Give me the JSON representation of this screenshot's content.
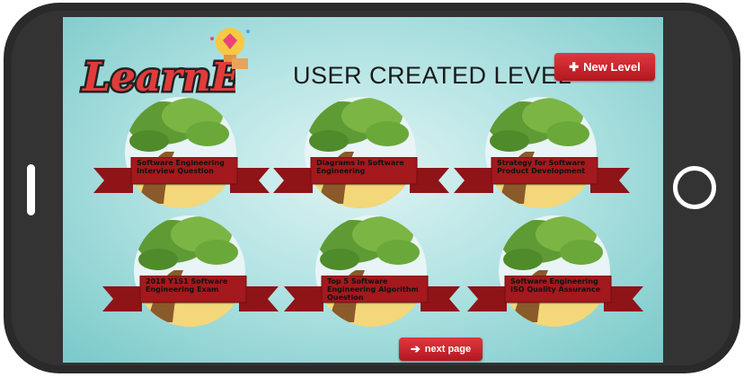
{
  "app": {
    "logo_text": "LearnEz",
    "title": "USER CREATED LEVEL"
  },
  "header": {
    "new_level_label": "New Level",
    "new_level_icon": "plus-icon"
  },
  "levels": [
    {
      "label": "Software Engineering Interview Question"
    },
    {
      "label": "Diagrams in Software Engineering"
    },
    {
      "label": "Strategy for Software Product Development"
    },
    {
      "label": "2018 Y1S1 Software Engineering Exam"
    },
    {
      "label": "Top 5 Software Engineering Algorithm Question"
    },
    {
      "label": "Software Engineering ISO Quality Assurance"
    }
  ],
  "footer": {
    "next_label": "next page",
    "next_icon": "arrow-right-icon"
  },
  "colors": {
    "accent_red": "#c4222a",
    "ribbon_red": "#a3191d",
    "bg_teal": "#7ccaca"
  }
}
